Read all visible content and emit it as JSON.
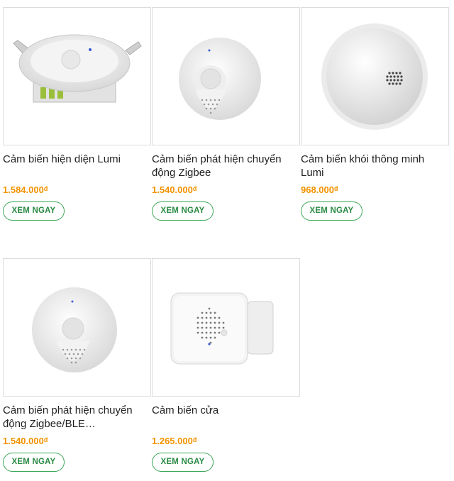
{
  "products": [
    {
      "title": "Cảm biến hiện diện Lumi",
      "price": "1.584.000",
      "currency": "đ",
      "button": "XEM NGAY",
      "image_icon": "ceiling-presence-sensor-icon"
    },
    {
      "title": "Cảm biến phát hiện chuyển động Zigbee",
      "price": "1.540.000",
      "currency": "đ",
      "button": "XEM NGAY",
      "image_icon": "motion-sensor-icon"
    },
    {
      "title": "Cảm biến khói thông minh Lumi",
      "price": "968.000",
      "currency": "đ",
      "button": "XEM NGAY",
      "image_icon": "smoke-detector-icon"
    },
    {
      "title": "Cảm biến phát hiện chuyển động Zigbee/BLE…",
      "price": "1.540.000",
      "currency": "đ",
      "button": "XEM NGAY",
      "image_icon": "motion-sensor-icon"
    },
    {
      "title": "Cảm biến cửa",
      "price": "1.265.000",
      "currency": "đ",
      "button": "XEM NGAY",
      "image_icon": "door-sensor-icon"
    }
  ],
  "colors": {
    "price": "#f39200",
    "button_border": "#3aa655",
    "button_text": "#2a8a44"
  }
}
